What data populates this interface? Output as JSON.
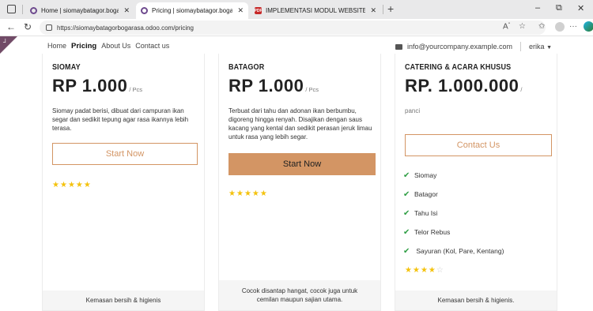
{
  "browser": {
    "tabs": [
      {
        "label": "Home | siomaybatagor.bogarasa",
        "favicon": "odoo-icon",
        "active": false
      },
      {
        "label": "Pricing | siomaybatagor.bogarasa",
        "favicon": "odoo-icon",
        "active": true
      },
      {
        "label": "IMPLEMENTASI MODUL WEBSITE",
        "favicon": "pdf-icon",
        "active": false
      }
    ],
    "url": "https://siomaybatagorbogarasa.odoo.com/pricing",
    "pdf_favicon_text": "PDF"
  },
  "site": {
    "nav": [
      {
        "label": "Home",
        "active": false
      },
      {
        "label": "Pricing",
        "active": true
      },
      {
        "label": "About Us",
        "active": false
      },
      {
        "label": "Contact us",
        "active": false
      }
    ],
    "email": "info@yourcompany.example.com",
    "user": "erika"
  },
  "cards": [
    {
      "title": "SIOMAY",
      "price": "RP 1.000",
      "unit": "/ Pcs",
      "description": "Siomay padat berisi, dibuat dari campuran ikan segar dan sedikit tepung agar rasa ikannya lebih terasa.",
      "button": "Start Now",
      "rating": 5,
      "footer": "Kemasan bersih & higienis"
    },
    {
      "title": "BATAGOR",
      "price": "RP 1.000",
      "unit": "/ Pcs",
      "description": "Terbuat dari tahu dan adonan ikan berbumbu, digoreng hingga renyah. Disajikan dengan saus kacang yang kental dan sedikit perasan jeruk limau untuk rasa yang lebih segar.",
      "button": "Start Now",
      "rating": 5,
      "footer": "Cocok disantap hangat, cocok juga untuk cemilan maupun sajian utama."
    },
    {
      "title": "CATERING & ACARA KHUSUS",
      "price": "RP. 1.000.000",
      "unit": "/",
      "description": "panci",
      "button": "Contact Us",
      "features": [
        "Siomay",
        "Batagor",
        "Tahu Isi",
        "Telor Rebus",
        " Sayuran (Kol, Pare, Kentang)"
      ],
      "rating": 4,
      "rating_max": 5,
      "footer": "Kemasan bersih & higienis."
    }
  ],
  "colors": {
    "accent": "#d39564",
    "star": "#f4c20d",
    "check": "#2e9e44",
    "odoo": "#714b67"
  }
}
